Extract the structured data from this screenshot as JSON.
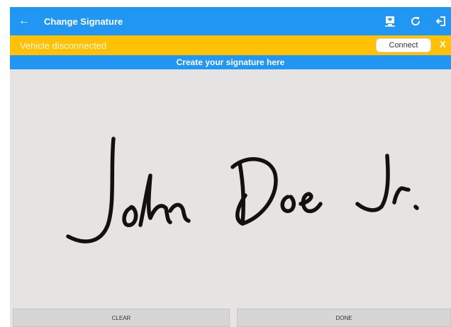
{
  "appbar": {
    "title": "Change Signature",
    "back_icon": "arrow-left-icon",
    "actions": [
      "device-sync-icon",
      "refresh-icon",
      "logout-icon"
    ]
  },
  "banner": {
    "message": "Vehicle disconnected",
    "connect_label": "Connect",
    "dismiss_label": "X"
  },
  "signature": {
    "header": "Create your signature here",
    "signed_text": "John Doe Jr."
  },
  "buttons": {
    "clear_label": "CLEAR",
    "done_label": "DONE"
  },
  "colors": {
    "primary": "#2196f3",
    "warning": "#ffc107",
    "canvas": "#e6e4e2"
  }
}
